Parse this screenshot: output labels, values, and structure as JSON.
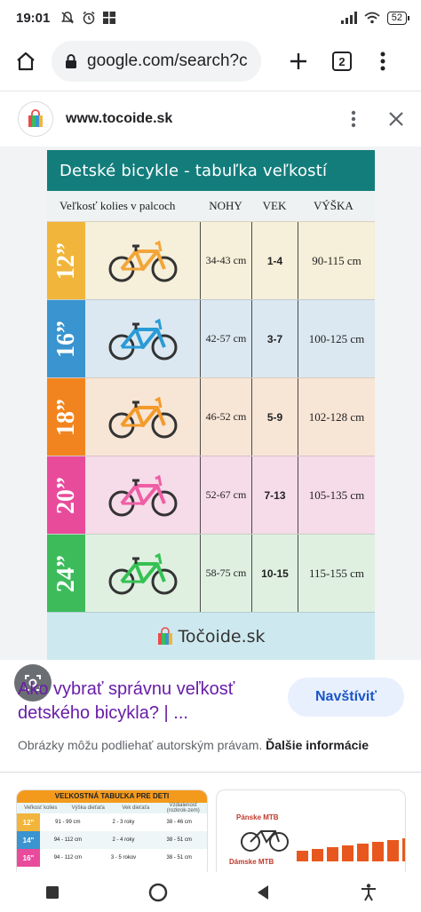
{
  "status_bar": {
    "time": "19:01",
    "battery": "52"
  },
  "browser": {
    "url": "google.com/search?c",
    "tab_count": "2"
  },
  "sheet": {
    "site_name": "www.tocoide.sk"
  },
  "chart_data": {
    "type": "table",
    "title": "Detské bicykle - tabuľka veľkostí",
    "columns": [
      "Veľkosť kolies v palcoch",
      "NOHY",
      "VEK",
      "VÝŠKA"
    ],
    "rows": [
      {
        "size": "12”",
        "legs": "34-43 cm",
        "age": "1-4",
        "height": "90-115 cm",
        "color": "#f2b53b",
        "bg": "#f6efd9",
        "bike_color": "#f2a53a"
      },
      {
        "size": "16”",
        "legs": "42-57 cm",
        "age": "3-7",
        "height": "100-125 cm",
        "color": "#3a94cf",
        "bg": "#dbe8f1",
        "bike_color": "#2a9bd6"
      },
      {
        "size": "18”",
        "legs": "46-52 cm",
        "age": "5-9",
        "height": "102-128 cm",
        "color": "#f2841f",
        "bg": "#f7e5d6",
        "bike_color": "#f39a2b"
      },
      {
        "size": "20”",
        "legs": "52-67 cm",
        "age": "7-13",
        "height": "105-135 cm",
        "color": "#e94b9b",
        "bg": "#f6dbe8",
        "bike_color": "#ee5fa6"
      },
      {
        "size": "24”",
        "legs": "58-75 cm",
        "age": "10-15",
        "height": "115-155 cm",
        "color": "#3dbb5b",
        "bg": "#dff0e1",
        "bike_color": "#35c153"
      }
    ],
    "footer_brand": "Točoide.sk"
  },
  "result": {
    "title": "Ako vybrať správnu veľkosť detského bicykla? | ...",
    "visit_label": "Navštíviť",
    "copyright_text": "Obrázky môžu podliehať autorským právam.",
    "more_info": "Ďalšie informácie"
  },
  "related": {
    "thumb1": {
      "title": "VEĽKOSTNÁ TABUĽKA PRE DETI",
      "headers": [
        "Veľkosť kolies",
        "Výška dieťaťa",
        "Vek dieťaťa",
        "Vzdialenosť (rozkrok-zem)"
      ],
      "rows": [
        {
          "size": "12\"",
          "height": "91 - 99 cm",
          "age": "2 - 3 roky",
          "inseam": "38 - 46 cm",
          "color": "#f2b53b"
        },
        {
          "size": "14\"",
          "height": "94 - 112 cm",
          "age": "2 - 4 roky",
          "inseam": "38 - 51 cm",
          "color": "#3a94cf"
        },
        {
          "size": "16\"",
          "height": "94 - 112 cm",
          "age": "3 - 5 rokov",
          "inseam": "38 - 51 cm",
          "color": "#e94b9b"
        }
      ]
    },
    "thumb2": {
      "label_men": "Pánske MTB",
      "label_women": "Dámske MTB"
    }
  }
}
